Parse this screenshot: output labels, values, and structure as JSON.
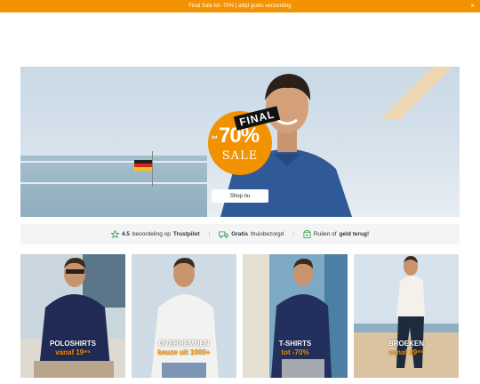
{
  "promo": {
    "text": "Final Sale tot -70% | altijd gratis verzending",
    "close_icon": "×"
  },
  "hero": {
    "badge_final": "FINAL",
    "badge_prefix": "tot",
    "badge_percent": "70%",
    "badge_word": "SALE",
    "shop_label": "Shop nu",
    "colors": {
      "accent": "#f39200",
      "shirt": "#2f5a97"
    }
  },
  "usps": {
    "rating_value": "4.5",
    "rating_text": "beoordeling op",
    "rating_brand": "Trustpilot",
    "shipping_bold": "Gratis",
    "shipping_text": "thuisbezorgd",
    "returns_text": "Ruilen of",
    "returns_bold": "geld terug!",
    "separator": "|"
  },
  "categories": [
    {
      "title": "POLOSHIRTS",
      "subtitle": "vanaf 19⁹⁵"
    },
    {
      "title": "OVERHEMDEN",
      "subtitle": "keuze uit 1000+"
    },
    {
      "title": "T-SHIRTS",
      "subtitle": "tot -70%"
    },
    {
      "title": "BROEKEN",
      "subtitle": "vanaf 29⁹⁵"
    }
  ]
}
